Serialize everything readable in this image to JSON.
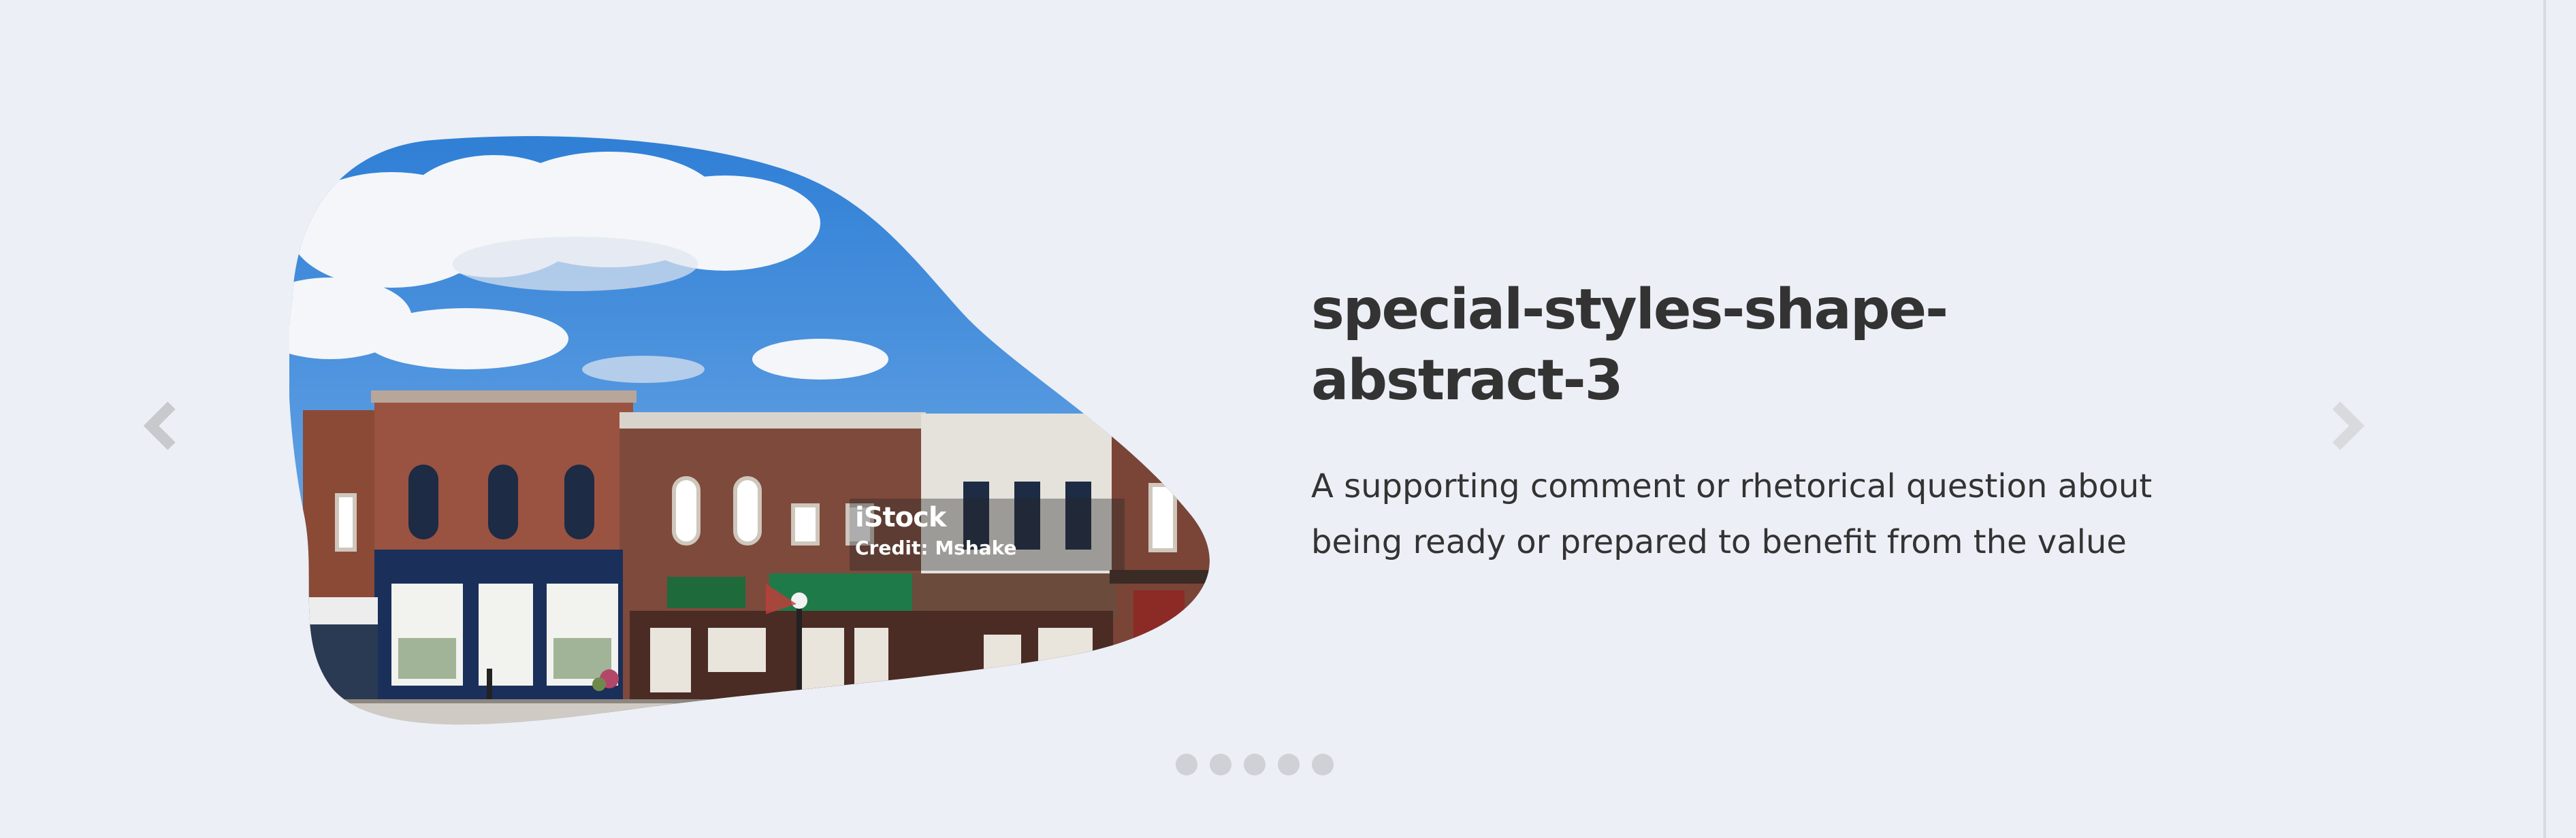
{
  "carousel": {
    "slide": {
      "title": "special-styles-shape-abstract-3",
      "text": "A supporting comment or rhetorical question about being ready or prepared to benefit from the value",
      "image": {
        "watermark_logo": "iStock",
        "watermark_credit": "Credit: Mshake"
      }
    },
    "prev_icon": "chevron-left-icon",
    "next_icon": "chevron-right-icon",
    "dots_count": 5,
    "active_dot": 0
  },
  "colors": {
    "background": "#eceff5",
    "text": "#333333",
    "arrow": "#c8c9cd",
    "dot": "#cfd1d6"
  }
}
